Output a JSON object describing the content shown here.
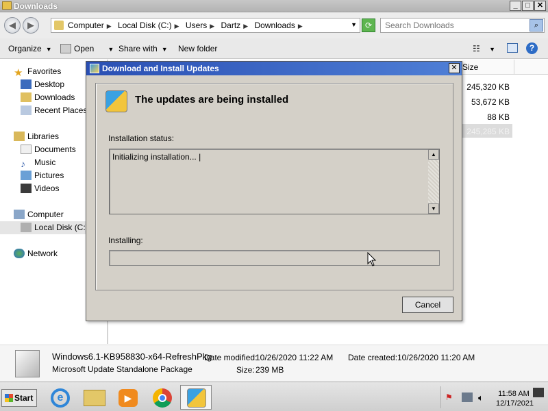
{
  "window": {
    "title": "Downloads",
    "controls": [
      "_",
      "□",
      "✕"
    ]
  },
  "address": {
    "crumbs": [
      "Computer",
      "Local Disk (C:)",
      "Users",
      "Dartz",
      "Downloads"
    ],
    "search_placeholder": "Search Downloads"
  },
  "toolbar": {
    "organize": "Organize",
    "open": "Open",
    "share_with": "Share with",
    "new_folder": "New folder"
  },
  "nav": {
    "favorites": "Favorites",
    "desktop": "Desktop",
    "downloads": "Downloads",
    "recent_places": "Recent Places",
    "libraries": "Libraries",
    "documents": "Documents",
    "music": "Music",
    "pictures": "Pictures",
    "videos": "Videos",
    "computer": "Computer",
    "local_disk": "Local Disk (C:)",
    "network": "Network"
  },
  "file_list": {
    "size_header": "Size",
    "sizes": [
      "245,320 KB",
      "53,672 KB",
      "88 KB",
      "245,285 KB"
    ]
  },
  "details": {
    "file_name": "Windows6.1-KB958830-x64-RefreshPkg",
    "file_type": "Microsoft Update Standalone Package",
    "date_modified_label": "Date modified:",
    "date_modified": "10/26/2020 11:22 AM",
    "date_created_label": "Date created:",
    "date_created": "10/26/2020 11:20 AM",
    "size_label": "Size:",
    "size": "239 MB"
  },
  "dialog": {
    "title": "Download and Install Updates",
    "close": "✕",
    "heading": "The updates are being installed",
    "status_label": "Installation status:",
    "status_text": "Initializing installation... |",
    "installing_label": "Installing:",
    "progress": 0,
    "cancel": "Cancel"
  },
  "taskbar": {
    "start": "Start",
    "time": "11:58 AM",
    "date": "12/17/2021"
  }
}
